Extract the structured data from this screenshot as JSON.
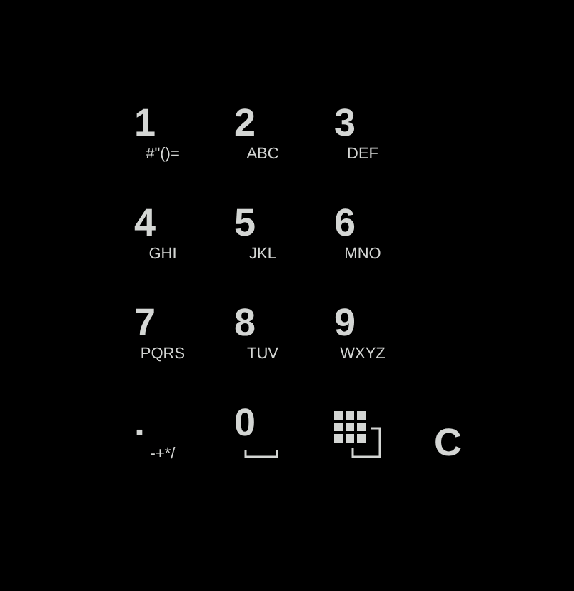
{
  "keys": [
    {
      "kind": "digit",
      "digit": "1",
      "letters": "#\"()="
    },
    {
      "kind": "digit",
      "digit": "2",
      "letters": "ABC"
    },
    {
      "kind": "digit",
      "digit": "3",
      "letters": "DEF"
    },
    {
      "kind": "digit",
      "digit": "4",
      "letters": "GHI"
    },
    {
      "kind": "digit",
      "digit": "5",
      "letters": "JKL"
    },
    {
      "kind": "digit",
      "digit": "6",
      "letters": "MNO"
    },
    {
      "kind": "digit",
      "digit": "7",
      "letters": "PQRS"
    },
    {
      "kind": "digit",
      "digit": "8",
      "letters": "TUV"
    },
    {
      "kind": "digit",
      "digit": "9",
      "letters": "WXYZ"
    },
    {
      "kind": "digit",
      "digit": ".",
      "letters": "-+*/"
    },
    {
      "kind": "space",
      "digit": "0"
    },
    {
      "kind": "layout"
    },
    {
      "kind": "clear",
      "digit": "C"
    }
  ]
}
